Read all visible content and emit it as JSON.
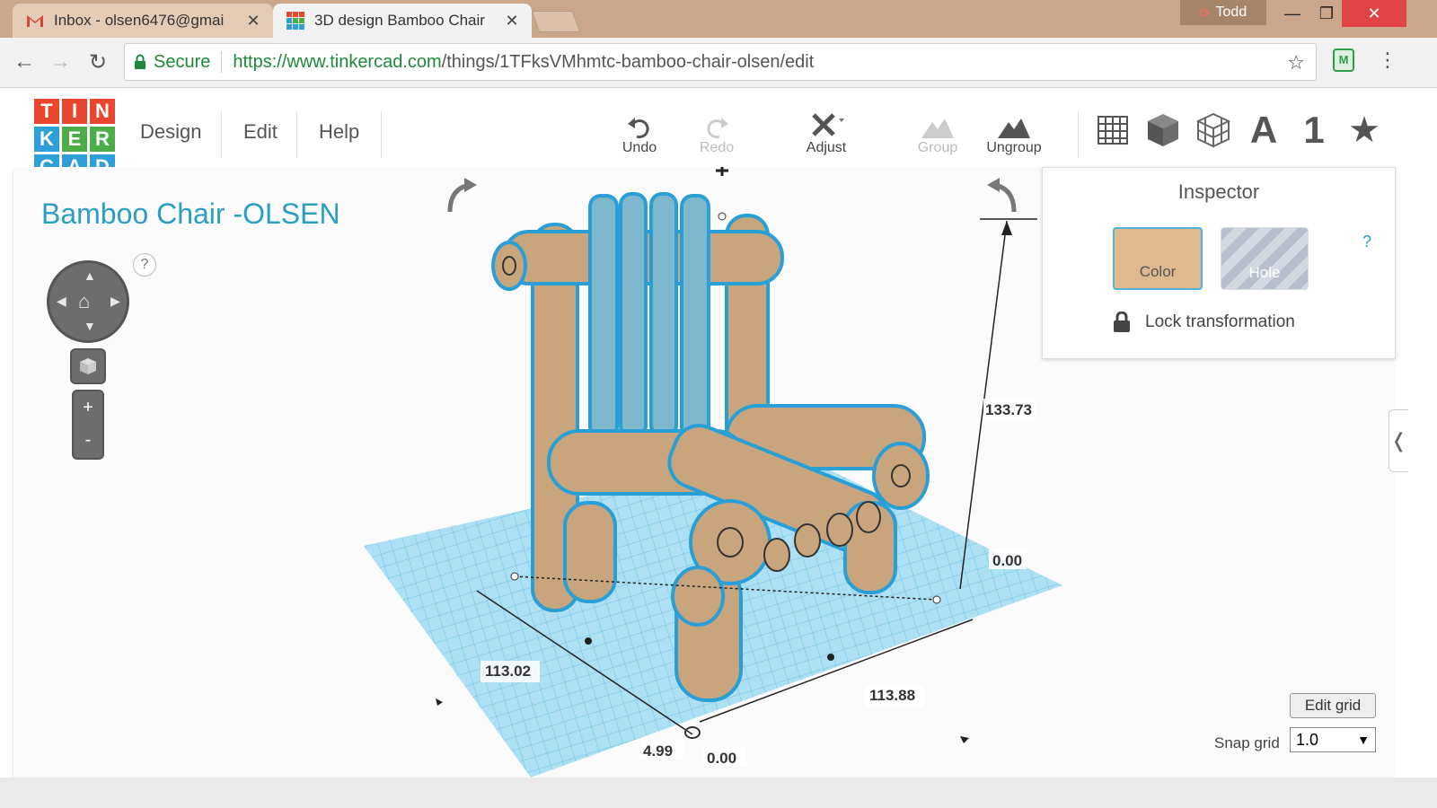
{
  "browser": {
    "tabs": [
      {
        "label": "Inbox - olsen6476@gmai",
        "icon": "gmail-icon"
      },
      {
        "label": "3D design Bamboo Chair",
        "icon": "tinkercad-icon"
      }
    ],
    "profile_name": "Todd",
    "secure_label": "Secure",
    "url_scheme": "https://",
    "url_host": "www.tinkercad.com",
    "url_path": "/things/1TFksVMhmtc-bamboo-chair-olsen/edit",
    "extension_label": "M"
  },
  "app": {
    "logo_letters": [
      "T",
      "I",
      "N",
      "K",
      "E",
      "R",
      "C",
      "A",
      "D"
    ],
    "logo_colors": [
      "#e8462e",
      "#e8462e",
      "#e8462e",
      "#2f9fd8",
      "#4bae49",
      "#4bae49",
      "#2f9fd8",
      "#2f9fd8",
      "#2f9fd8"
    ],
    "menu": [
      "Design",
      "Edit",
      "Help"
    ],
    "tools": {
      "undo": "Undo",
      "redo": "Redo",
      "adjust": "Adjust",
      "group": "Group",
      "ungroup": "Ungroup"
    },
    "view_tools": {
      "text_tool": "A",
      "number_tool": "1"
    }
  },
  "design": {
    "title": "Bamboo Chair -OLSEN",
    "help": "?"
  },
  "inspector": {
    "title": "Inspector",
    "color_label": "Color",
    "hole_label": "Hole",
    "help": "?",
    "lock_label": "Lock transformation",
    "color_value": "#dfb98f"
  },
  "dimensions": {
    "height": "133.73",
    "top_offset": "0.00",
    "width_left": "113.02",
    "width_right": "113.88",
    "elevation": "4.99",
    "bottom_offset": "0.00"
  },
  "grid": {
    "edit_label": "Edit grid",
    "snap_label": "Snap grid",
    "snap_value": "1.0"
  },
  "colors": {
    "accent": "#2b9fc2",
    "chair_wood": "#c9a57e",
    "chair_slat": "#7fb7cc",
    "workplane": "#a9dcf0"
  }
}
